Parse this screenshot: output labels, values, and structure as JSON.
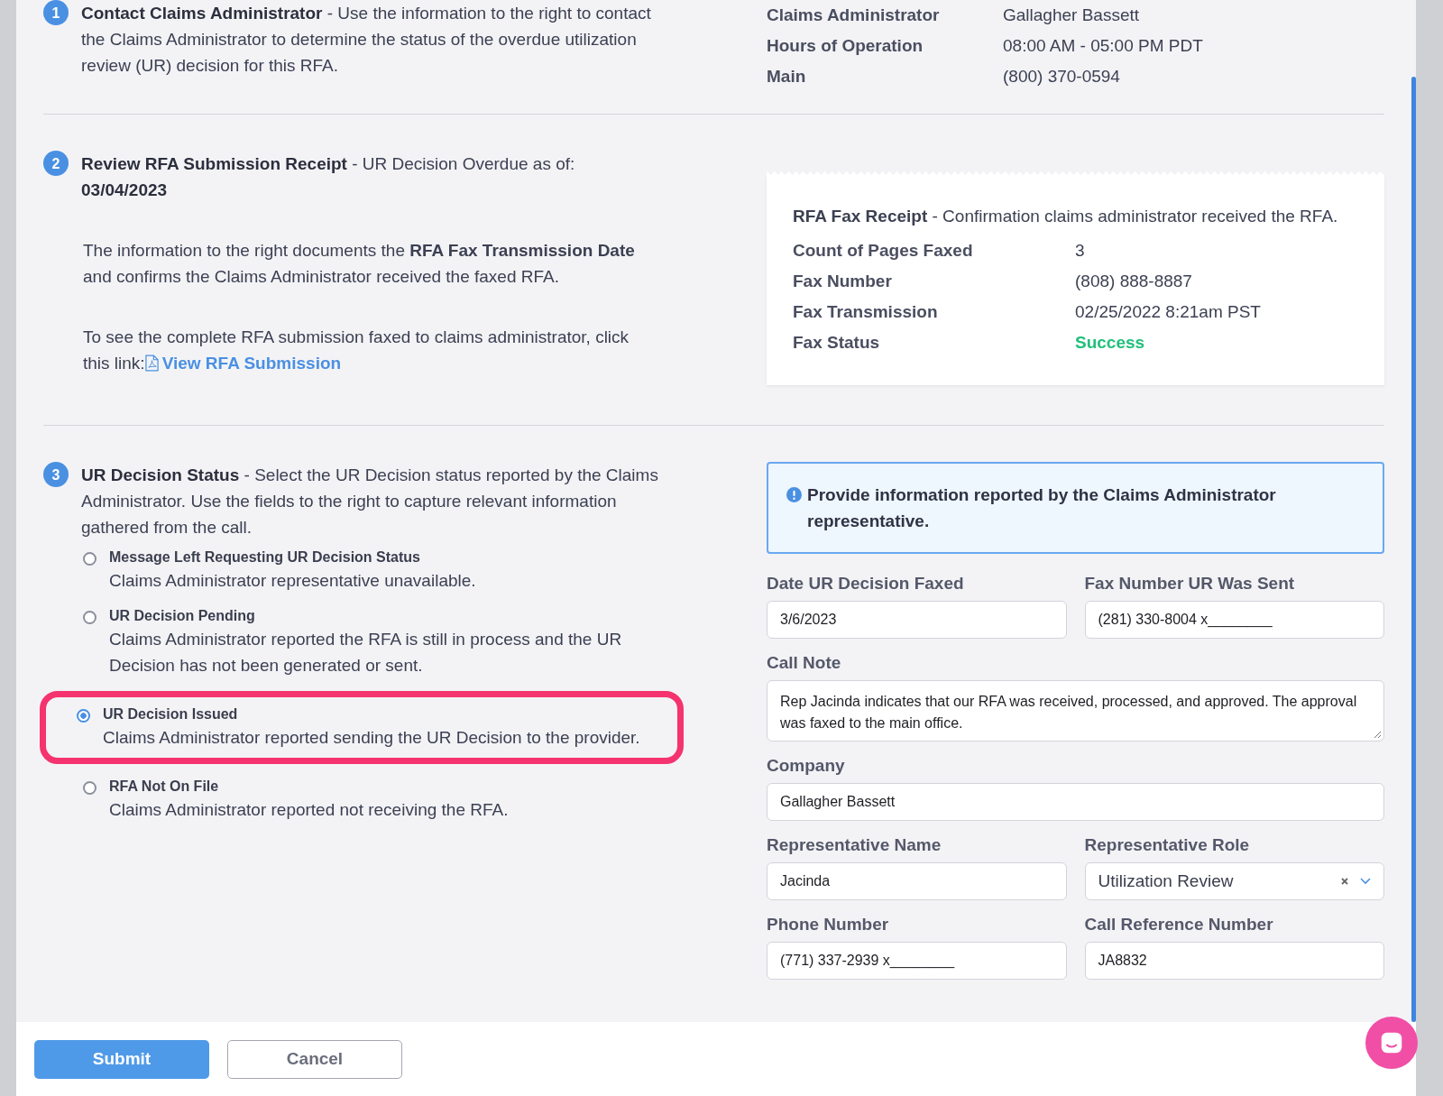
{
  "contact": {
    "number": "1",
    "heading": "**Contact Claims Administrator** - Use the information to the right to contact the Claims Administrator to determine the status of the overdue utilization review (UR) decision for this RFA.",
    "details": [
      {
        "label": "Claims Administrator",
        "value": "Gallagher Bassett"
      },
      {
        "label": "Hours of Operation",
        "value": "08:00 AM - 05:00 PM PDT"
      },
      {
        "label": "Main",
        "value": "(800) 370-0594"
      }
    ]
  },
  "receipt_step": {
    "number": "2",
    "heading": "**Review RFA Submission Receipt** - UR Decision Overdue as of: **03/04/2023**",
    "paragraph": "The information to the right documents the **RFA Fax Transmission Date** and confirms the Claims Administrator received the faxed RFA.",
    "link_intro": "To see the complete RFA submission faxed to claims administrator, click this link:",
    "link": "View RFA Submission",
    "receipt": {
      "heading": "**RFA Fax Receipt** - Confirmation claims administrator received the RFA.",
      "rows": [
        {
          "label": "Count of Pages Faxed",
          "value": "3",
          "kind": "plain"
        },
        {
          "label": "Fax Number",
          "value": "(808) 888-8887",
          "kind": "plain"
        },
        {
          "label": "Fax Transmission",
          "value": "02/25/2022 8:21am PST",
          "kind": "plain"
        },
        {
          "label": "Fax Status",
          "value": "Success",
          "kind": "status"
        }
      ]
    }
  },
  "status_step": {
    "number": "3",
    "heading": "**UR Decision Status** - Select the UR Decision status reported by the Claims Administrator. Use the fields to the right to capture relevant information gathered from the call.",
    "options": [
      {
        "title": "Message Left Requesting UR Decision Status",
        "description": "Claims Administrator representative unavailable.",
        "selected": false,
        "highlighted": false
      },
      {
        "title": "UR Decision Pending",
        "description": "Claims Administrator reported the RFA is still in process and the UR Decision has not been generated or sent.",
        "selected": false,
        "highlighted": false
      },
      {
        "title": "UR Decision Issued",
        "description": "Claims Administrator reported sending the UR Decision to the provider.",
        "selected": true,
        "highlighted": true
      },
      {
        "title": "RFA Not On File",
        "description": "Claims Administrator reported not receiving the RFA.",
        "selected": false,
        "highlighted": false
      }
    ],
    "notice": "Provide information reported by the Claims Administrator representative.",
    "fields": [
      {
        "label": "Date UR Decision Faxed",
        "value": "3/6/2023",
        "kind": "text"
      },
      {
        "label": "Fax Number UR Was Sent",
        "value": "(281) 330-8004 x________",
        "kind": "text"
      },
      {
        "label": "Call Note",
        "value": "Rep Jacinda indicates that our RFA was received, processed, and approved. The approval was faxed to the main office.",
        "kind": "textarea"
      },
      {
        "label": "Company",
        "value": "Gallagher Bassett",
        "kind": "wide_text"
      },
      {
        "label": "Representative Name",
        "value": "Jacinda",
        "kind": "text"
      },
      {
        "label": "Representative Role",
        "value": "Utilization Review",
        "kind": "select"
      },
      {
        "label": "Phone Number",
        "value": "(771) 337-2939 x________",
        "kind": "text"
      },
      {
        "label": "Call Reference Number",
        "value": "JA8832",
        "kind": "text"
      }
    ]
  },
  "footer": {
    "submit": "Submit",
    "cancel": "Cancel"
  }
}
